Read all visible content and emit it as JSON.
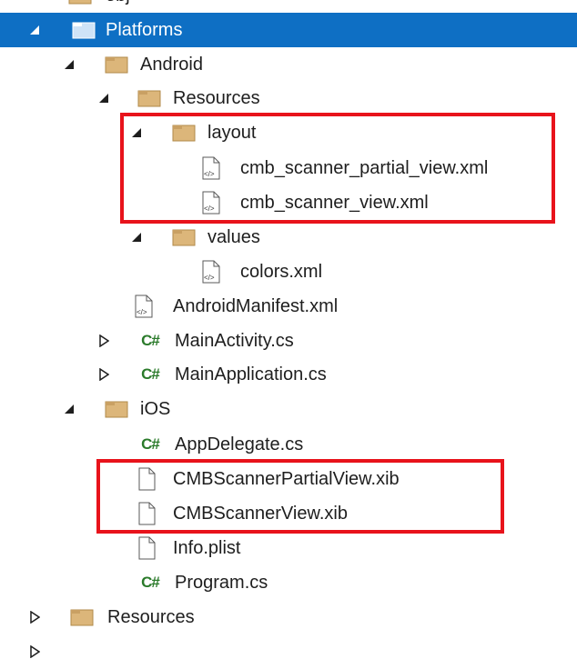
{
  "colors": {
    "selection": "#0e6fc4",
    "folder": "#dcb67a",
    "csharp": "#2a7a2a",
    "callout": "#e8131b"
  },
  "tree": {
    "top_partial": {
      "label": "obj",
      "icon": "folder-icon"
    },
    "platforms": {
      "label": "Platforms",
      "icon": "folder-icon",
      "expanded": true,
      "selected": true
    },
    "android": {
      "label": "Android",
      "icon": "folder-icon",
      "expanded": true
    },
    "resources": {
      "label": "Resources",
      "icon": "folder-icon",
      "expanded": true
    },
    "layout": {
      "label": "layout",
      "icon": "folder-icon",
      "expanded": true
    },
    "cmb_scanner_partial_view": {
      "label": "cmb_scanner_partial_view.xml",
      "icon": "xml-file-icon"
    },
    "cmb_scanner_view": {
      "label": "cmb_scanner_view.xml",
      "icon": "xml-file-icon"
    },
    "values": {
      "label": "values",
      "icon": "folder-icon",
      "expanded": true
    },
    "colors_xml": {
      "label": "colors.xml",
      "icon": "xml-file-icon"
    },
    "android_manifest": {
      "label": "AndroidManifest.xml",
      "icon": "xml-file-icon"
    },
    "main_activity": {
      "label": "MainActivity.cs",
      "icon": "csharp-file-icon",
      "icon_text": "C#",
      "expanded": false
    },
    "main_application": {
      "label": "MainApplication.cs",
      "icon": "csharp-file-icon",
      "icon_text": "C#",
      "expanded": false
    },
    "ios": {
      "label": "iOS",
      "icon": "folder-icon",
      "expanded": true
    },
    "app_delegate": {
      "label": "AppDelegate.cs",
      "icon": "csharp-file-icon",
      "icon_text": "C#"
    },
    "cmb_scanner_partial_view_xib": {
      "label": "CMBScannerPartialView.xib",
      "icon": "file-icon"
    },
    "cmb_scanner_view_xib": {
      "label": "CMBScannerView.xib",
      "icon": "file-icon"
    },
    "info_plist": {
      "label": "Info.plist",
      "icon": "file-icon"
    },
    "program_cs": {
      "label": "Program.cs",
      "icon": "csharp-file-icon",
      "icon_text": "C#"
    },
    "resources_root": {
      "label": "Resources",
      "icon": "folder-icon",
      "expanded": false
    }
  }
}
